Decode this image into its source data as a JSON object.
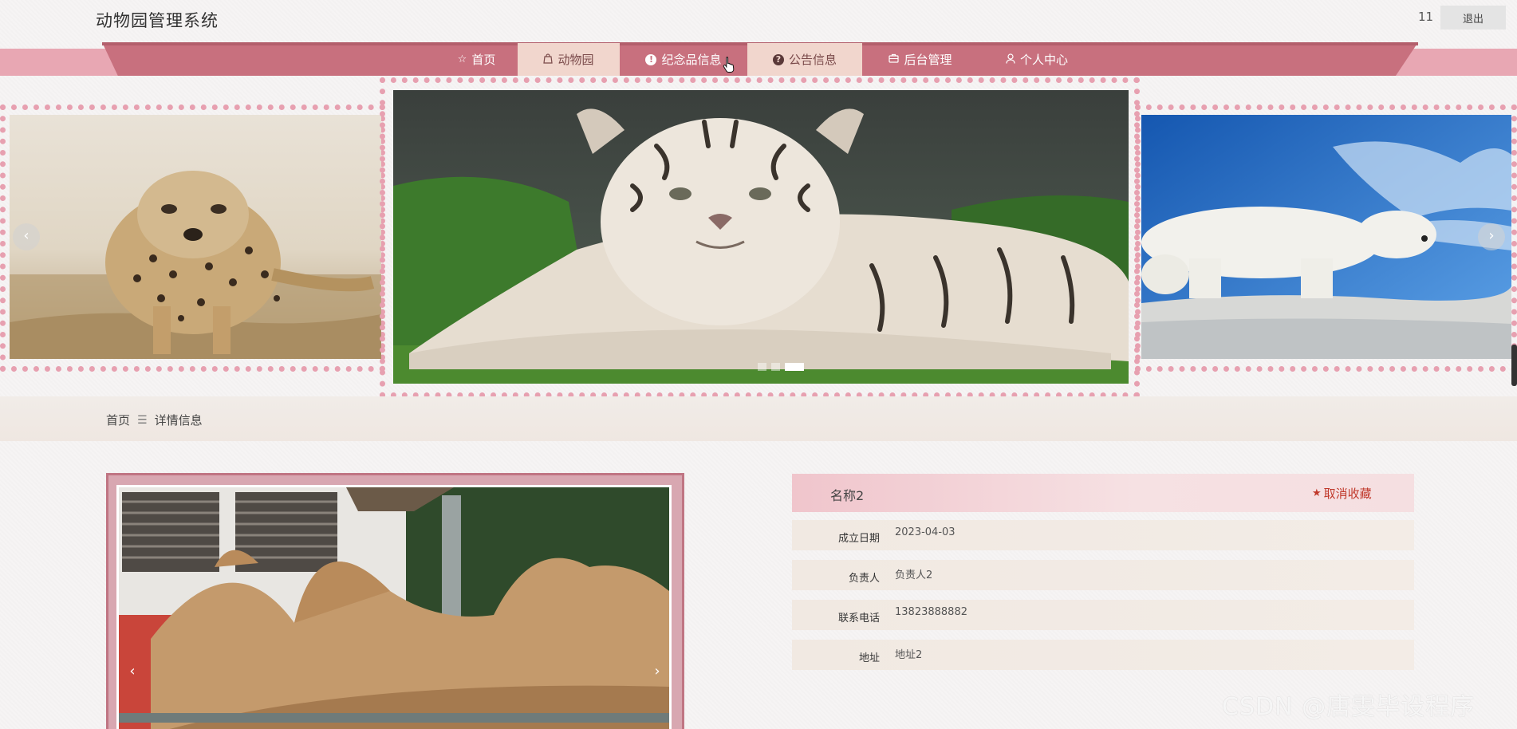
{
  "header": {
    "site_title": "动物园管理系统",
    "user_name": "11",
    "logout_label": "退出"
  },
  "nav": {
    "items": [
      {
        "label": "首页",
        "icon": "star-outline-icon"
      },
      {
        "label": "动物园",
        "icon": "bag-icon"
      },
      {
        "label": "纪念品信息",
        "icon": "info-circle-icon"
      },
      {
        "label": "公告信息",
        "icon": "question-circle-icon"
      },
      {
        "label": "后台管理",
        "icon": "briefcase-icon"
      },
      {
        "label": "个人中心",
        "icon": "user-icon"
      }
    ]
  },
  "carousel": {
    "prev_label": "‹",
    "next_label": "›",
    "slides": [
      "cheetah",
      "white-tiger",
      "polar-bear"
    ],
    "active_index": 2,
    "indicator_count": 3
  },
  "breadcrumb": {
    "home": "首页",
    "separator": "☰",
    "current": "详情信息"
  },
  "detail": {
    "name": "名称2",
    "favorite_label": "取消收藏",
    "favorite_color": "#c0392b",
    "image": "camel",
    "fields": [
      {
        "label": "成立日期",
        "value": "2023-04-03"
      },
      {
        "label": "负责人",
        "value": "负责人2"
      },
      {
        "label": "联系电话",
        "value": "13823888882"
      },
      {
        "label": "地址",
        "value": "地址2"
      }
    ]
  },
  "colors": {
    "nav_primary": "#c8707e",
    "nav_active_tab": "#f1d6cd",
    "dotted_border": "#e7a0b0"
  },
  "watermark": "CSDN @唐雯毕设程序"
}
